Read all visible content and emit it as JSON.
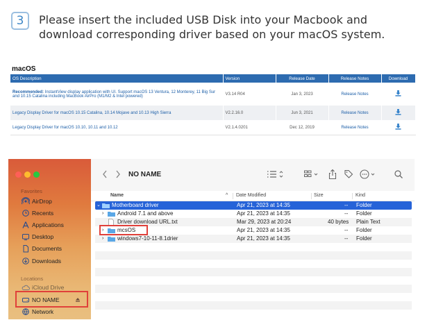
{
  "step": {
    "number": "3",
    "text": "Please insert the included USB Disk into your Macbook and download corresponding driver based on your macOS system."
  },
  "downloads": {
    "section_title": "macOS",
    "headers": [
      "OS Description",
      "Version",
      "Release Date",
      "Release Notes",
      "Download"
    ],
    "rows": [
      {
        "recommended": "Recommended:",
        "description": " InstantView display application with UI. Support macOS 13 Ventura, 12 Monterey, 11 Big Sur and 10.15 Catalina including MacBook AirPro (M1/M2 & Intel powered)",
        "version": "V3.14 R04",
        "date": "Jan 3, 2023",
        "notes": "Release Notes"
      },
      {
        "recommended": "",
        "description": "Legacy Display Driver for macOS 10.15 Catalina, 10.14 Mojave and 10.13 High Sierra",
        "version": "V2.2.16.0",
        "date": "Jun 3, 2021",
        "notes": "Release Notes"
      },
      {
        "recommended": "",
        "description": "Legacy Display Driver for macOS 10.10, 10.11 and 10.12",
        "version": "V2.1.4.0201",
        "date": "Dec 12, 2019",
        "notes": "Release Notes"
      }
    ],
    "download_icon": "download-icon"
  },
  "finder": {
    "title": "NO NAME",
    "sidebar": {
      "favorites_label": "Favorites",
      "favorites": [
        {
          "label": "AirDrop",
          "icon": "airdrop-icon"
        },
        {
          "label": "Recents",
          "icon": "clock-icon"
        },
        {
          "label": "Applications",
          "icon": "applications-icon"
        },
        {
          "label": "Desktop",
          "icon": "desktop-icon"
        },
        {
          "label": "Documents",
          "icon": "document-icon"
        },
        {
          "label": "Downloads",
          "icon": "downloads-icon"
        }
      ],
      "locations_label": "Locations",
      "locations": [
        {
          "label": "iCloud Drive",
          "icon": "cloud-icon"
        },
        {
          "label": "NO NAME",
          "icon": "drive-icon"
        },
        {
          "label": "Network",
          "icon": "network-icon"
        }
      ]
    },
    "columns": {
      "name": "Name",
      "date": "Date Modified",
      "size": "Size",
      "kind": "Kind"
    },
    "files": [
      {
        "name": "Motherboard driver",
        "date": "Apr 21, 2023 at 14:35",
        "size": "--",
        "kind": "Folder",
        "type": "folder",
        "expanded": true,
        "depth": 0,
        "selected": true
      },
      {
        "name": "Android 7.1 and above",
        "date": "Apr 21, 2023 at 14:35",
        "size": "--",
        "kind": "Folder",
        "type": "folder",
        "expanded": false,
        "depth": 1,
        "selected": false
      },
      {
        "name": "Driver download URL.txt",
        "date": "Mar 29, 2023 at 20:24",
        "size": "40 bytes",
        "kind": "Plain Text",
        "type": "file",
        "depth": 1,
        "selected": false
      },
      {
        "name": "mcsOS",
        "date": "Apr 21, 2023 at 14:35",
        "size": "--",
        "kind": "Folder",
        "type": "folder",
        "expanded": false,
        "depth": 0,
        "selected": false
      },
      {
        "name": "windows7-10-11-8.1drier",
        "date": "Apr 21, 2023 at 14:35",
        "size": "--",
        "kind": "Folder",
        "type": "folder",
        "expanded": false,
        "depth": 0,
        "selected": false
      }
    ],
    "colors": {
      "selection": "#2663d8",
      "highlight_box": "#e0403a",
      "folder": "#5aa7e6"
    }
  }
}
